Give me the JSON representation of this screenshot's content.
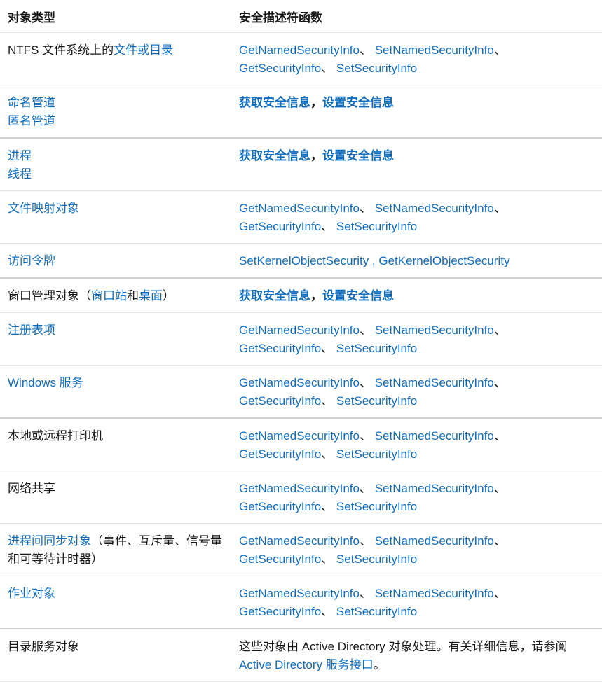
{
  "header": {
    "col1": "对象类型",
    "col2": "安全描述符函数"
  },
  "fn": {
    "get_named": "GetNamedSecurityInfo",
    "set_named": "SetNamedSecurityInfo",
    "get": "GetSecurityInfo",
    "set": "SetSecurityInfo",
    "sep": "、 ",
    "sep_end": "、",
    "get_cn": "获取安全信息",
    "set_cn": "设置安全信息",
    "comma_cn": "，",
    "set_kernel": "SetKernelObjectSecurity",
    "get_kernel": "GetKernelObjectSecurity",
    "kernel_sep": " , "
  },
  "rows": {
    "ntfs": {
      "prefix": "NTFS 文件系统上的",
      "link": "文件或目录"
    },
    "pipe": {
      "named": "命名管道",
      "anon": "匿名管道"
    },
    "proc": {
      "process": "进程",
      "thread": "线程"
    },
    "filemap": "文件映射对象",
    "token": "访问令牌",
    "window": {
      "prefix": "窗口管理对象（",
      "station": "窗口站",
      "and": "和",
      "desktop": "桌面",
      "suffix": "）"
    },
    "registry": "注册表项",
    "service": "Windows 服务",
    "printer": "本地或远程打印机",
    "share": "网络共享",
    "sync": {
      "link": "进程间同步对象",
      "rest": "（事件、互斥量、信号量和可等待计时器）"
    },
    "job": "作业对象",
    "dir": {
      "name": "目录服务对象",
      "desc": "这些对象由 Active Directory 对象处理。有关详细信息，请参阅",
      "link": "Active Directory 服务接口",
      "end": "。"
    }
  }
}
